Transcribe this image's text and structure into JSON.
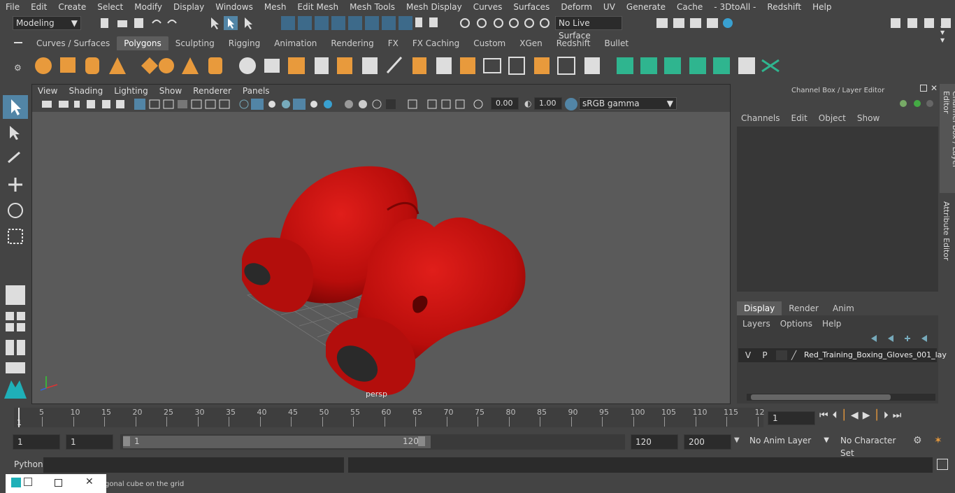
{
  "menubar": [
    "File",
    "Edit",
    "Create",
    "Select",
    "Modify",
    "Display",
    "Windows",
    "Mesh",
    "Edit Mesh",
    "Mesh Tools",
    "Mesh Display",
    "Curves",
    "Surfaces",
    "Deform",
    "UV",
    "Generate",
    "Cache",
    "- 3DtoAll -",
    "Redshift",
    "Help"
  ],
  "status": {
    "mode": "Modeling",
    "live_surface": "No Live Surface"
  },
  "shelf_tabs": [
    "Curves / Surfaces",
    "Polygons",
    "Sculpting",
    "Rigging",
    "Animation",
    "Rendering",
    "FX",
    "FX Caching",
    "Custom",
    "XGen",
    "Redshift",
    "Bullet"
  ],
  "shelf_active": "Polygons",
  "viewport": {
    "menus": [
      "View",
      "Shading",
      "Lighting",
      "Show",
      "Renderer",
      "Panels"
    ],
    "exposure": "0.00",
    "gamma": "1.00",
    "colorspace": "sRGB gamma",
    "camera_label": "persp"
  },
  "channelbox": {
    "title": "Channel Box / Layer Editor",
    "menus": [
      "Channels",
      "Edit",
      "Object",
      "Show"
    ],
    "layer_tabs": [
      "Display",
      "Render",
      "Anim"
    ],
    "layer_tab_active": "Display",
    "layer_menus": [
      "Layers",
      "Options",
      "Help"
    ],
    "layer": {
      "v": "V",
      "p": "P",
      "name": "Red_Training_Boxing_Gloves_001_lay"
    }
  },
  "side_tabs": {
    "channel": "Channel Box / Layer Editor",
    "attribute": "Attribute Editor"
  },
  "timeline": {
    "ticks": [
      "5",
      "10",
      "15",
      "20",
      "25",
      "30",
      "35",
      "40",
      "45",
      "50",
      "55",
      "60",
      "65",
      "70",
      "75",
      "80",
      "85",
      "90",
      "95",
      "100",
      "105",
      "110",
      "115",
      "12"
    ],
    "start_marker": "1",
    "current_frame": "1"
  },
  "range": {
    "start": "1",
    "start2": "1",
    "slider_start": "1",
    "slider_end": "120",
    "end": "120",
    "end2": "200",
    "anim_layer": "No Anim Layer",
    "char_set": "No Character Set"
  },
  "python": {
    "label": "Python"
  },
  "helpline": "gonal cube on the grid",
  "colors": {
    "glove_red": "#c0100e",
    "accent": "#5285a6"
  }
}
